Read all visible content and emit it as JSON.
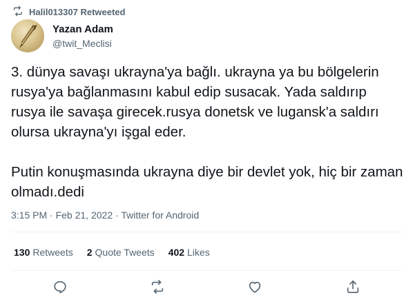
{
  "retweet_banner": {
    "icon": "retweet-icon",
    "text": "Halil013307 Retweeted"
  },
  "author": {
    "display_name": "Yazan Adam",
    "handle": "@twit_Meclisi",
    "avatar": "quill-pen-avatar"
  },
  "tweet": {
    "paragraphs": [
      "3. dünya savaşı ukrayna'ya bağlı. ukrayna ya bu bölgelerin rusya'ya bağlanmasını kabul edip susacak. Yada saldırıp rusya ile savaşa girecek.rusya donetsk ve lugansk'a saldırı olursa ukrayna'yı işgal eder.",
      "Putin konuşmasında ukrayna diye bir devlet yok, hiç bir zaman olmadı.dedi"
    ]
  },
  "meta": {
    "time": "3:15 PM",
    "separator": "·",
    "date": "Feb 21, 2022",
    "client": "Twitter for Android"
  },
  "stats": {
    "retweets_count": "130",
    "retweets_label": "Retweets",
    "quotes_count": "2",
    "quotes_label": "Quote Tweets",
    "likes_count": "402",
    "likes_label": "Likes"
  },
  "actions": {
    "reply": "reply-icon",
    "retweet": "retweet-icon",
    "like": "heart-icon",
    "share": "share-icon"
  },
  "colors": {
    "text_primary": "#0f1419",
    "text_secondary": "#536471",
    "divider": "#eff3f4"
  }
}
